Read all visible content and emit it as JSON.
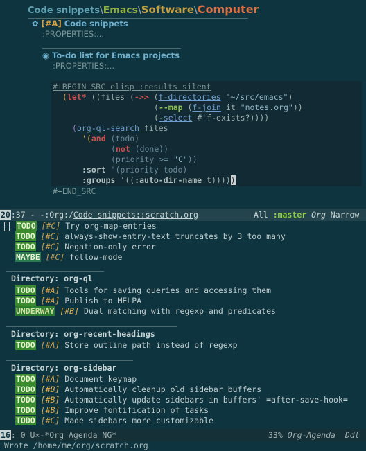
{
  "breadcrumb": {
    "part1": "Code snippets",
    "sep": "\\",
    "part2": "Emacs",
    "part3": "Software",
    "part4": "Computer"
  },
  "org": {
    "heading1_bullet": "✿",
    "heading1_priority": "[#A]",
    "heading1_title": "Code snippets",
    "properties_1": ":PROPERTIES:...",
    "heading2_bullet": "◉",
    "heading2_title": "To-do list for Emacs projects",
    "properties_2": ":PROPERTIES:...",
    "src_begin": "#+BEGIN_SRC elisp :results silent",
    "src_end": "#+END_SRC"
  },
  "code": {
    "l1_a": "(",
    "l1_let": "let*",
    "l1_b": " ((files (",
    "l1_thread": "->>",
    "l1_c": " (",
    "l1_fdir": "f-directories",
    "l1_str": " \"~/src/emacs\"",
    "l1_d": ")",
    "l2_a": "(",
    "l2_map": "--map",
    "l2_b": " (",
    "l2_fjoin": "f-join",
    "l2_c": " it ",
    "l2_str": "\"notes.org\"",
    "l2_d": "))",
    "l3_a": "(",
    "l3_select": "-select",
    "l3_b": " #'f-exists?))))",
    "l4_a": "(",
    "l4_fn": "org-ql-search",
    "l4_b": " files",
    "l5_a": "'(",
    "l5_and": "and",
    "l5_b": " (todo)",
    "l6_a": "(",
    "l6_not": "not",
    "l6_b": " (done))",
    "l7_a": "(priority >= ",
    "l7_str": "\"C\"",
    "l7_b": "))",
    "l8_sort": ":sort",
    "l8_b": " '(priority todo)",
    "l9_groups": ":groups",
    "l9_b": " '((",
    "l9_kw": ":auto-dir-name",
    "l9_c": " t))))",
    "l9_cursor": ")"
  },
  "modeline_top": {
    "num": "20",
    "rest_a": ":37 - -:Org:/",
    "file": "Code snippets::scratch.org",
    "right_all": "All ",
    "branch": ":master",
    "mode": " Org",
    "extra": " Narrow"
  },
  "agenda": {
    "ungrouped": [
      {
        "kw": "TODO",
        "pri": "[#C]",
        "text": "Try org-map-entries"
      },
      {
        "kw": "TODO",
        "pri": "[#C]",
        "text": "always-show-entry-text truncates by 3 too many"
      },
      {
        "kw": "TODO",
        "pri": "[#C]",
        "text": "Negation-only error"
      },
      {
        "kw": "MAYBE",
        "pri": "[#C]",
        "text": "follow-mode"
      }
    ],
    "group1": {
      "title": "Directory: org-ql",
      "items": [
        {
          "kw": "TODO",
          "pri": "[#A]",
          "text": "Tools for saving queries and accessing them"
        },
        {
          "kw": "TODO",
          "pri": "[#A]",
          "text": "Publish to MELPA"
        },
        {
          "kw": "UNDERWAY",
          "pri": "[#B]",
          "text": "Dual matching with regexp and predicates"
        }
      ]
    },
    "group2": {
      "title": "Directory: org-recent-headings",
      "items": [
        {
          "kw": "TODO",
          "pri": "[#A]",
          "text": "Store outline path instead of regexp"
        }
      ]
    },
    "group3": {
      "title": "Directory: org-sidebar",
      "items": [
        {
          "kw": "TODO",
          "pri": "[#A]",
          "text": "Document keymap"
        },
        {
          "kw": "TODO",
          "pri": "[#B]",
          "text": "Automatically cleanup old sidebar buffers"
        },
        {
          "kw": "TODO",
          "pri": "[#B]",
          "text": "Automatically update sidebars in buffers' =after-save-hook="
        },
        {
          "kw": "TODO",
          "pri": "[#B]",
          "text": "Improve fontification of tasks"
        },
        {
          "kw": "TODO",
          "pri": "[#C]",
          "text": "Made sidebars more customizable"
        }
      ]
    }
  },
  "modeline_bottom": {
    "num": "16",
    "rest_a": ": 0 U×-",
    "buffer": "*Org Agenda NG*",
    "percent": "33%",
    "mode": "Org-Agenda",
    "extra": "Ddl"
  },
  "echo": "Wrote /home/me/org/scratch.org",
  "colors": {
    "background": "#0e3440",
    "todo": "#3a8a30",
    "heading": "#6fb0cc"
  }
}
